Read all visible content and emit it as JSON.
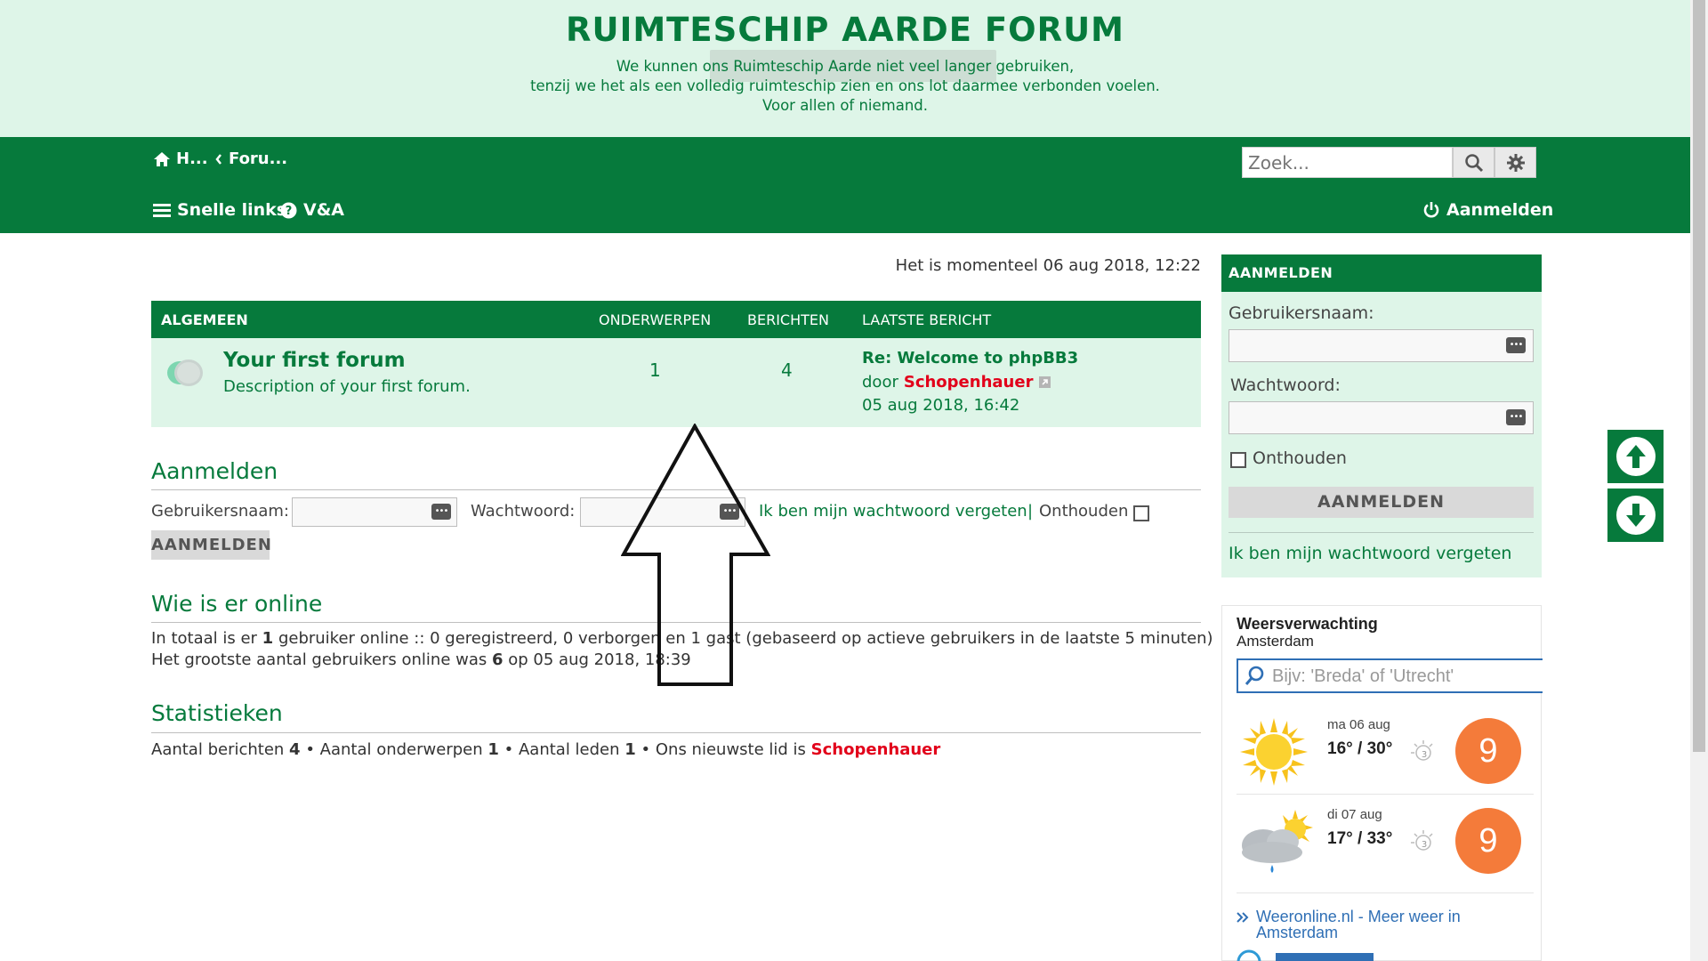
{
  "header": {
    "title": "RUIMTESCHIP AARDE FORUM",
    "tagline_1": "We kunnen ons Ruimteschip Aarde niet veel langer gebruiken,",
    "tagline_2": "tenzij we het als een volledig ruimteschip zien en ons lot daarmee verbonden voelen.",
    "tagline_3": "Voor allen of niemand."
  },
  "nav": {
    "home": "H...",
    "forum": "Foru...",
    "quick_links": "Snelle links",
    "faq": "V&A",
    "login": "Aanmelden",
    "search_placeholder": "Zoek..."
  },
  "main": {
    "date": "Het is momenteel 06 aug 2018, 12:22",
    "table": {
      "col_category": "ALGEMEEN",
      "col_topics": "ONDERWERPEN",
      "col_posts": "BERICHTEN",
      "col_last": "LAATSTE BERICHT",
      "rows": [
        {
          "title": "Your first forum",
          "description": "Description of your first forum.",
          "topics": "1",
          "posts": "4",
          "last_title": "Re: Welcome to phpBB3",
          "last_by": "door",
          "last_author": "Schopenhauer",
          "last_date": "05 aug 2018, 16:42"
        }
      ]
    },
    "login": {
      "title": "Aanmelden",
      "username_label": "Gebruikersnaam:",
      "password_label": "Wachtwoord:",
      "forgot": "Ik ben mijn wachtwoord vergeten",
      "separator": "|",
      "remember": "Onthouden",
      "button": "AANMELDEN"
    },
    "online": {
      "title": "Wie is er online",
      "line1_a": "In totaal is er",
      "line1_b": "1",
      "line1_c": "gebruiker online :: 0 geregistreerd, 0 verborgen en 1 gast (gebaseerd op actieve gebruikers in de laatste 5 minuten)",
      "line2_a": "Het grootste aantal gebruikers online was",
      "line2_b": "6",
      "line2_c": "op 05 aug 2018, 18:39"
    },
    "stats": {
      "title": "Statistieken",
      "posts_label": "Aantal berichten",
      "posts": "4",
      "topics_label": "• Aantal onderwerpen",
      "topics": "1",
      "members_label": "• Aantal leden",
      "members": "1",
      "newest_label": "• Ons nieuwste lid is",
      "newest": "Schopenhauer"
    }
  },
  "sidebar": {
    "login": {
      "header": "AANMELDEN",
      "username_label": "Gebruikersnaam:",
      "password_label": "Wachtwoord:",
      "remember": "Onthouden",
      "button": "AANMELDEN",
      "forgot": "Ik ben mijn wachtwoord vergeten"
    },
    "weather": {
      "title": "Weersverwachting",
      "city": "Amsterdam",
      "search_placeholder": "Bijv: 'Breda' of 'Utrecht'",
      "days": [
        {
          "day": "ma 06 aug",
          "temps": "16° / 30°",
          "score": "9",
          "moon": "3"
        },
        {
          "day": "di 07 aug",
          "temps": "17° / 33°",
          "score": "9",
          "moon": "3"
        }
      ],
      "link": "Weeronline.nl - Meer weer in Amsterdam",
      "link_line1": "Weeronline.nl - Meer weer in",
      "link_line2": "Amsterdam"
    }
  },
  "colors": {
    "brand_green": "#067a3c",
    "light_green": "#def5e8",
    "author_red": "#e2001a",
    "score_orange": "#f47b3a"
  }
}
